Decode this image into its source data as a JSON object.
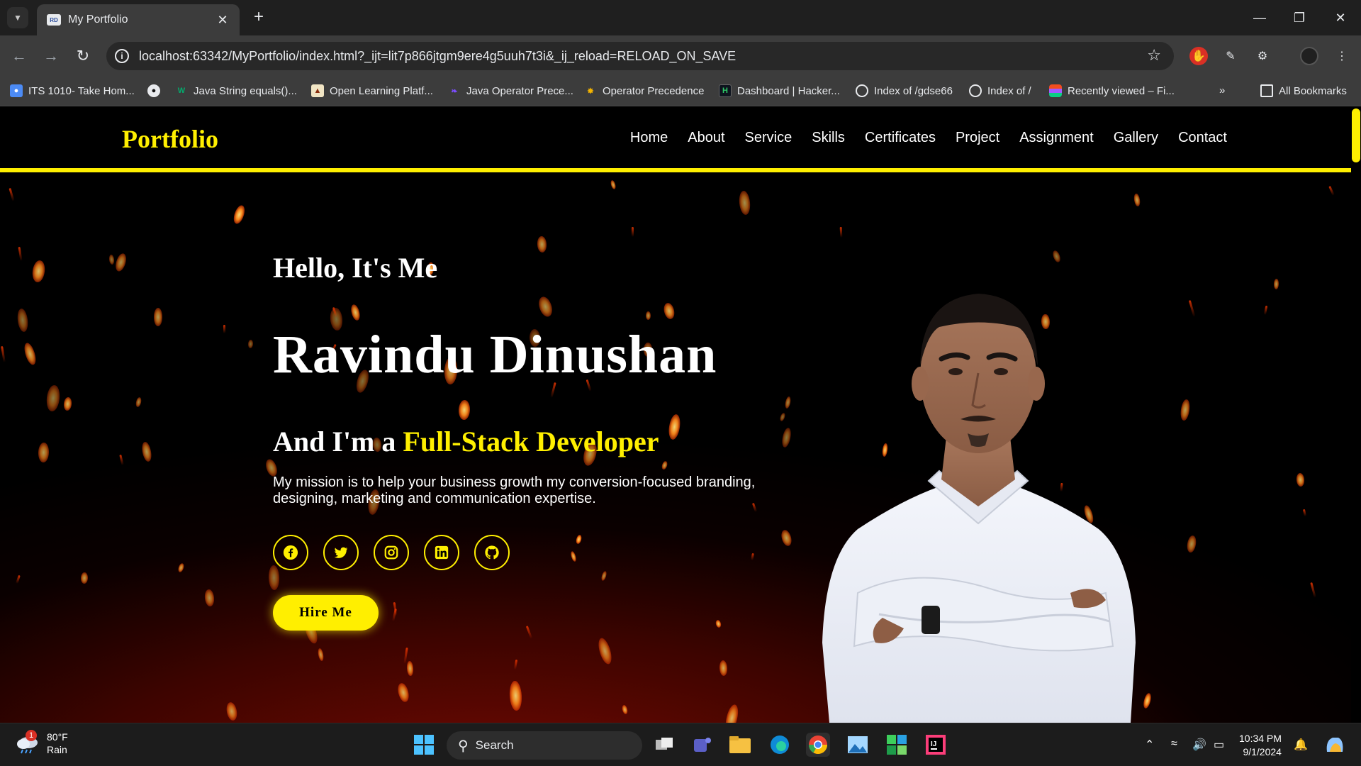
{
  "browser": {
    "tab_title": "My Portfolio",
    "tab_favicon_text": "RD",
    "url": "localhost:63342/MyPortfolio/index.html?_ijt=lit7p866jtgm9ere4g5uuh7t3i&_ij_reload=RELOAD_ON_SAVE",
    "bookmarks": [
      {
        "label": "ITS 1010- Take Hom...",
        "icon": "classroom-icon"
      },
      {
        "label": "",
        "icon": "github-icon"
      },
      {
        "label": "Java String equals()...",
        "icon": "w3-icon"
      },
      {
        "label": "Open Learning Platf...",
        "icon": "university-icon"
      },
      {
        "label": "Java Operator Prece...",
        "icon": "feather-icon"
      },
      {
        "label": "Operator Precedence",
        "icon": "bee-icon"
      },
      {
        "label": "Dashboard | Hacker...",
        "icon": "hackerrank-icon"
      },
      {
        "label": "Index of /gdse66",
        "icon": "globe-icon"
      },
      {
        "label": "Index of /",
        "icon": "globe-icon"
      },
      {
        "label": "Recently viewed – Fi...",
        "icon": "figma-icon"
      }
    ],
    "all_bookmarks_label": "All Bookmarks"
  },
  "site": {
    "logo": "Portfolio",
    "nav": [
      "Home",
      "About",
      "Service",
      "Skills",
      "Certificates",
      "Project",
      "Assignment",
      "Gallery",
      "Contact"
    ],
    "hello": "Hello, It's Me",
    "name": "Ravindu Dinushan",
    "role_prefix": "And I'm a ",
    "role_highlight": "Full-Stack Developer",
    "mission": "My mission is to help your business growth my conversion-focused branding, designing, marketing and communication expertise.",
    "socials": [
      "facebook-icon",
      "twitter-icon",
      "instagram-icon",
      "linkedin-icon",
      "github-icon"
    ],
    "hire_label": "Hire Me",
    "accent_color": "#ffef00"
  },
  "taskbar": {
    "weather_temp": "80°F",
    "weather_desc": "Rain",
    "weather_badge": "1",
    "search_label": "Search",
    "time": "10:34 PM",
    "date": "9/1/2024"
  }
}
